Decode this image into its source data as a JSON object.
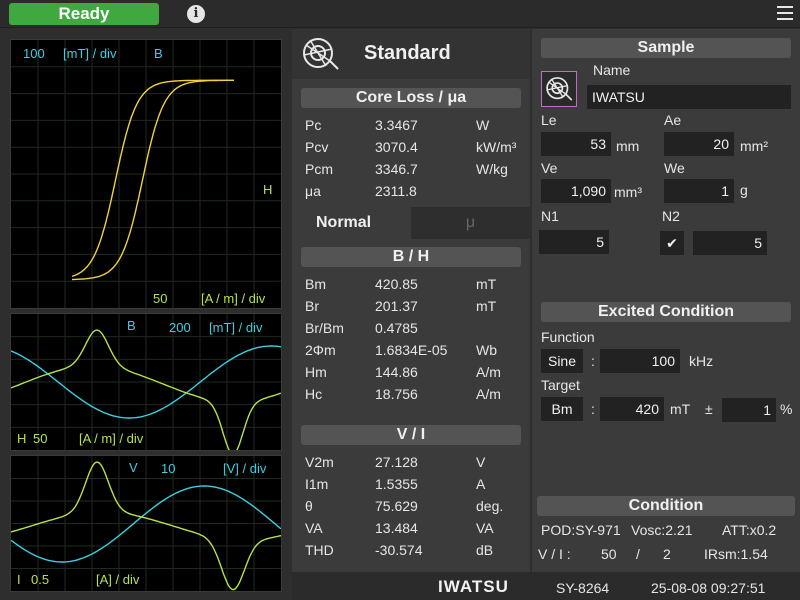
{
  "topbar": {
    "status": "Ready",
    "info_icon": "info-icon",
    "menu_icon": "hamburger-menu-icon"
  },
  "plots": {
    "bh": {
      "y_scale": "100",
      "y_unit": "[mT] / div",
      "y_name": "B",
      "x_name": "H",
      "x_scale": "50",
      "x_unit": "[A / m] / div"
    },
    "waveB": {
      "y_name": "B",
      "y_scale": "200",
      "y_unit": "[mT] / div",
      "x_name": "H",
      "x_scale": "50",
      "x_unit": "[A / m] / div"
    },
    "waveV": {
      "y_name": "V",
      "y_scale": "10",
      "y_unit": "[V] / div",
      "x_name": "I",
      "x_scale": "0.5",
      "x_unit": "[A] / div"
    }
  },
  "middle": {
    "mode_title": "Standard",
    "coreloss": {
      "header": "Core Loss / μa",
      "rows": [
        {
          "label": "Pc",
          "value": "3.3467",
          "unit": "W"
        },
        {
          "label": "Pcv",
          "value": "3070.4",
          "unit": "kW/m³"
        },
        {
          "label": "Pcm",
          "value": "3346.7",
          "unit": "W/kg"
        },
        {
          "label": "μa",
          "value": "2311.8",
          "unit": ""
        }
      ]
    },
    "tabs": {
      "normal": "Normal",
      "mu": "μ"
    },
    "bh": {
      "header": "B / H",
      "rows": [
        {
          "label": "Bm",
          "value": "420.85",
          "unit": "mT"
        },
        {
          "label": "Br",
          "value": "201.37",
          "unit": "mT"
        },
        {
          "label": "Br/Bm",
          "value": "0.4785",
          "unit": ""
        },
        {
          "label": "2Φm",
          "value": "1.6834E-05",
          "unit": "Wb"
        },
        {
          "label": "Hm",
          "value": "144.86",
          "unit": "A/m"
        },
        {
          "label": "Hc",
          "value": "18.756",
          "unit": "A/m"
        }
      ]
    },
    "vi": {
      "header": "V / I",
      "rows": [
        {
          "label": "V2m",
          "value": "27.128",
          "unit": "V"
        },
        {
          "label": "I1m",
          "value": "1.5355",
          "unit": "A"
        },
        {
          "label": "θ",
          "value": "75.629",
          "unit": "deg."
        },
        {
          "label": "VA",
          "value": "13.484",
          "unit": "VA"
        },
        {
          "label": "THD",
          "value": "-30.574",
          "unit": "dB"
        }
      ]
    }
  },
  "sample": {
    "header": "Sample",
    "name_label": "Name",
    "name_value": "IWATSU",
    "le_label": "Le",
    "le_value": "53",
    "le_unit": "mm",
    "ae_label": "Ae",
    "ae_value": "20",
    "ae_unit": "mm²",
    "ve_label": "Ve",
    "ve_value": "1,090",
    "ve_unit": "mm³",
    "we_label": "We",
    "we_value": "1",
    "we_unit": "g",
    "n1_label": "N1",
    "n1_value": "5",
    "n2_label": "N2",
    "n2_value": "5",
    "n2_checked": "✔"
  },
  "excited": {
    "header": "Excited Condition",
    "function_label": "Function",
    "function_type": "Sine",
    "colon1": ":",
    "freq_value": "100",
    "freq_unit": "kHz",
    "target_label": "Target",
    "target_type": "Bm",
    "colon2": ":",
    "target_value": "420",
    "target_unit": "mT",
    "pm": "±",
    "tol_value": "1",
    "tol_unit": "%"
  },
  "condition": {
    "header": "Condition",
    "line1_a": "POD:SY-971",
    "line1_b": "Vosc:2.21",
    "line1_c": "ATT:x0.2",
    "line2_a": "V / I :",
    "line2_b": "50",
    "line2_c": "/",
    "line2_d": "2",
    "line2_e": "IRsm:1.54"
  },
  "footer": {
    "brand": "IWATSU",
    "model": "SY-8264",
    "datetime": "25-08-08 09:27:51"
  },
  "colors": {
    "ready": "#3fa83f",
    "cyan": "#3ad0e0",
    "yellow": "#f2d13c",
    "green": "#b6e24a"
  }
}
